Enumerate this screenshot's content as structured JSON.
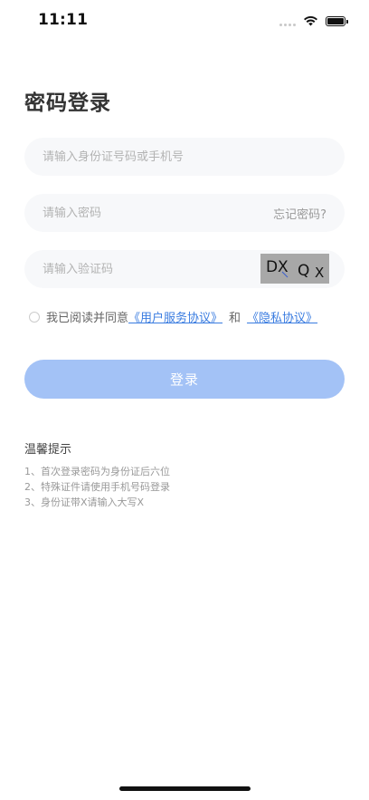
{
  "status_bar": {
    "time": "11:11"
  },
  "page": {
    "title": "密码登录"
  },
  "form": {
    "id_placeholder": "请输入身份证号码或手机号",
    "password_placeholder": "请输入密码",
    "forgot_label": "忘记密码?",
    "captcha_placeholder": "请输入验证码",
    "captcha_text": "DXQX"
  },
  "agreement": {
    "prefix": "我已阅读并同意",
    "service_link": "《用户服务协议》",
    "and": "和",
    "privacy_link": "《隐私协议》",
    "checked": false
  },
  "login_button": {
    "label": "登录",
    "color": "#a3c2f6"
  },
  "tips": {
    "title": "温馨提示",
    "items": [
      "1、首次登录密码为身份证后六位",
      "2、特殊证件请使用手机号码登录",
      "3、身份证带X请输入大写X"
    ]
  },
  "colors": {
    "link": "#3a7ce0",
    "field_bg": "#f7f8fa",
    "captcha_bg": "#a8a8a8"
  },
  "icons": {
    "signal": "signal-icon",
    "wifi": "wifi-icon",
    "battery": "battery-icon"
  }
}
